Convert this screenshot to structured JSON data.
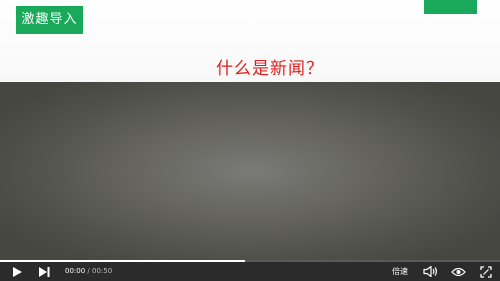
{
  "slide": {
    "tag_label": "激趣导入",
    "heading": "什么是新闻？"
  },
  "player": {
    "current_time": "00:00",
    "separator": "/",
    "duration": "00:50",
    "speed_label": "倍速",
    "progress_fraction": 0.49
  },
  "colors": {
    "accent_green": "#1aa95a",
    "heading_red": "#e02020",
    "control_bar": "#2b2b2b"
  },
  "icons": [
    "play-icon",
    "next-icon",
    "volume-icon",
    "eye-icon",
    "fullscreen-icon"
  ]
}
